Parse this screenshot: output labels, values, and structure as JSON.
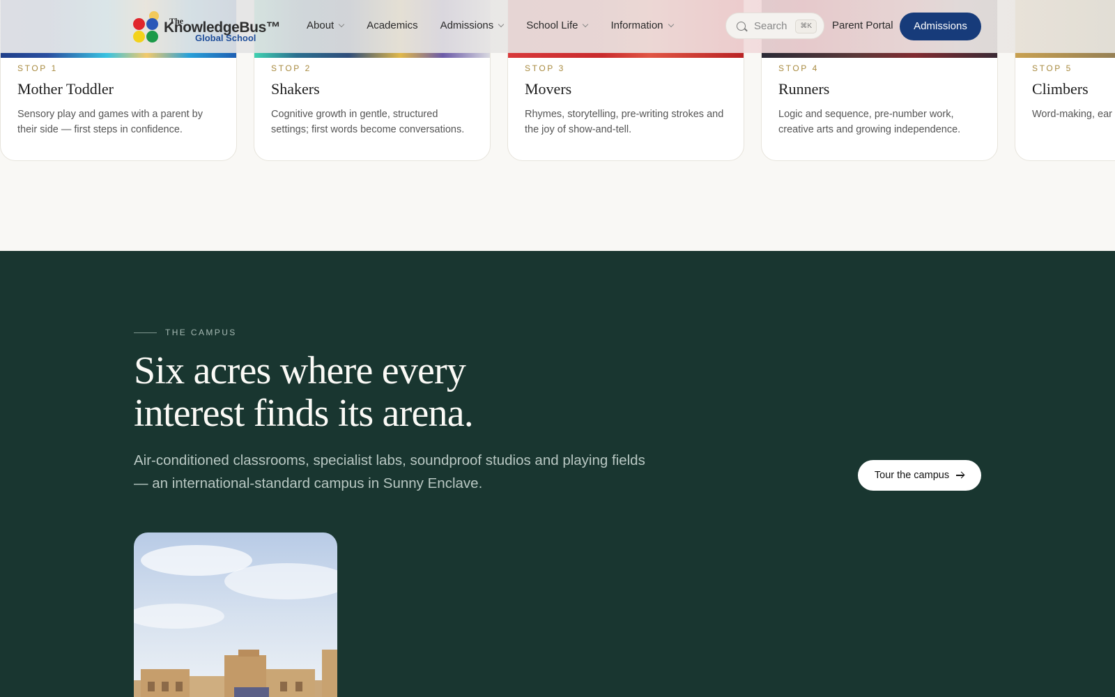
{
  "header": {
    "logo": {
      "the": "The",
      "main": "KnowledgeBus™",
      "sub": "Global School"
    },
    "nav": [
      {
        "label": "About",
        "has_menu": true
      },
      {
        "label": "Academics",
        "has_menu": false
      },
      {
        "label": "Admissions",
        "has_menu": true
      },
      {
        "label": "School Life",
        "has_menu": true
      },
      {
        "label": "Information",
        "has_menu": true
      }
    ],
    "search": {
      "placeholder": "Search",
      "shortcut": "⌘K"
    },
    "portal_label": "Parent Portal",
    "admissions_label": "Admissions"
  },
  "stops": [
    {
      "label": "STOP 1",
      "title": "Mother Toddler",
      "desc": "Sensory play and games with a parent by their side — first steps in confidence."
    },
    {
      "label": "STOP 2",
      "title": "Shakers",
      "desc": "Cognitive growth in gentle, structured settings; first words become conversations."
    },
    {
      "label": "STOP 3",
      "title": "Movers",
      "desc": "Rhymes, storytelling, pre-writing strokes and the joy of show-and-tell."
    },
    {
      "label": "STOP 4",
      "title": "Runners",
      "desc": "Logic and sequence, pre-number work, creative arts and growing independence."
    },
    {
      "label": "STOP 5",
      "title": "Climbers",
      "desc": "Word-making, ear environmental sci"
    }
  ],
  "campus": {
    "eyebrow": "THE CAMPUS",
    "headline_line1": "Six acres where every",
    "headline_line2": "interest finds its arena.",
    "description": "Air-conditioned classrooms, specialist labs, soundproof studios and playing fields — an international-standard campus in Sunny Enclave.",
    "tour_label": "Tour the campus"
  },
  "colors": {
    "primary_navy": "#173b7a",
    "campus_green": "#193630",
    "stop_gold": "#a88a3f"
  }
}
